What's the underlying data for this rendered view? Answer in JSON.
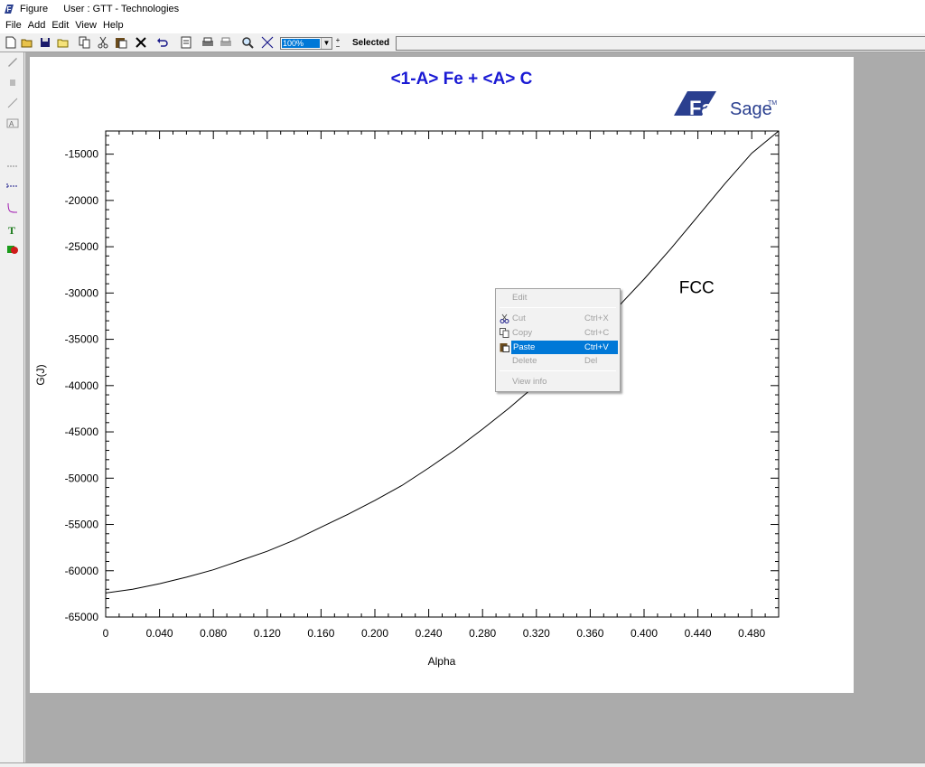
{
  "window": {
    "title": "Figure",
    "user": "User : GTT - Technologies"
  },
  "menu": [
    "File",
    "Add",
    "Edit",
    "View",
    "Help"
  ],
  "toolbar": {
    "zoom": "100%",
    "selected_label": "Selected",
    "selected_value": ""
  },
  "colors": {
    "title": "#1a1ad4",
    "logo": "#2a3f8f",
    "highlight": "#0078d7",
    "canvas_bg": "#ababab"
  },
  "logo": {
    "text_fact": "Fact",
    "text_sage": "Sage",
    "tm": "TM"
  },
  "chart_data": {
    "type": "line",
    "title": "<1-A> Fe  +  <A> C",
    "xlabel": "Alpha",
    "ylabel": "G(J)",
    "xlim": [
      0,
      0.5
    ],
    "ylim": [
      -65000,
      -12500
    ],
    "x_ticks": [
      "0",
      "0.040",
      "0.080",
      "0.120",
      "0.160",
      "0.200",
      "0.240",
      "0.280",
      "0.320",
      "0.360",
      "0.400",
      "0.440",
      "0.480"
    ],
    "y_ticks": [
      "-15000",
      "-20000",
      "-25000",
      "-30000",
      "-35000",
      "-40000",
      "-45000",
      "-50000",
      "-55000",
      "-60000",
      "-65000"
    ],
    "series": [
      {
        "name": "FCC",
        "x": [
          0,
          0.02,
          0.04,
          0.06,
          0.08,
          0.1,
          0.12,
          0.14,
          0.16,
          0.18,
          0.2,
          0.22,
          0.24,
          0.26,
          0.28,
          0.3,
          0.32,
          0.34,
          0.36,
          0.38,
          0.4,
          0.42,
          0.44,
          0.46,
          0.48,
          0.5
        ],
        "y": [
          -62400,
          -62000,
          -61400,
          -60700,
          -59900,
          -58900,
          -57900,
          -56700,
          -55300,
          -53900,
          -52400,
          -50800,
          -48900,
          -46900,
          -44700,
          -42400,
          -39900,
          -37300,
          -34500,
          -31600,
          -28500,
          -25200,
          -21700,
          -18200,
          -14900,
          -12500
        ]
      }
    ],
    "annotations": [
      {
        "text": "FCC",
        "x": 0.426,
        "y": -30000
      }
    ]
  },
  "context_menu": {
    "items": [
      {
        "label": "Edit",
        "shortcut": "",
        "enabled": false,
        "icon": ""
      },
      {
        "label": "Cut",
        "shortcut": "Ctrl+X",
        "enabled": false,
        "icon": "scissors-icon"
      },
      {
        "label": "Copy",
        "shortcut": "Ctrl+C",
        "enabled": false,
        "icon": "copy-icon"
      },
      {
        "label": "Paste",
        "shortcut": "Ctrl+V",
        "enabled": true,
        "icon": "paste-icon"
      },
      {
        "label": "Delete",
        "shortcut": "Del",
        "enabled": false,
        "icon": ""
      },
      {
        "label": "View info",
        "shortcut": "",
        "enabled": false,
        "icon": ""
      }
    ]
  }
}
